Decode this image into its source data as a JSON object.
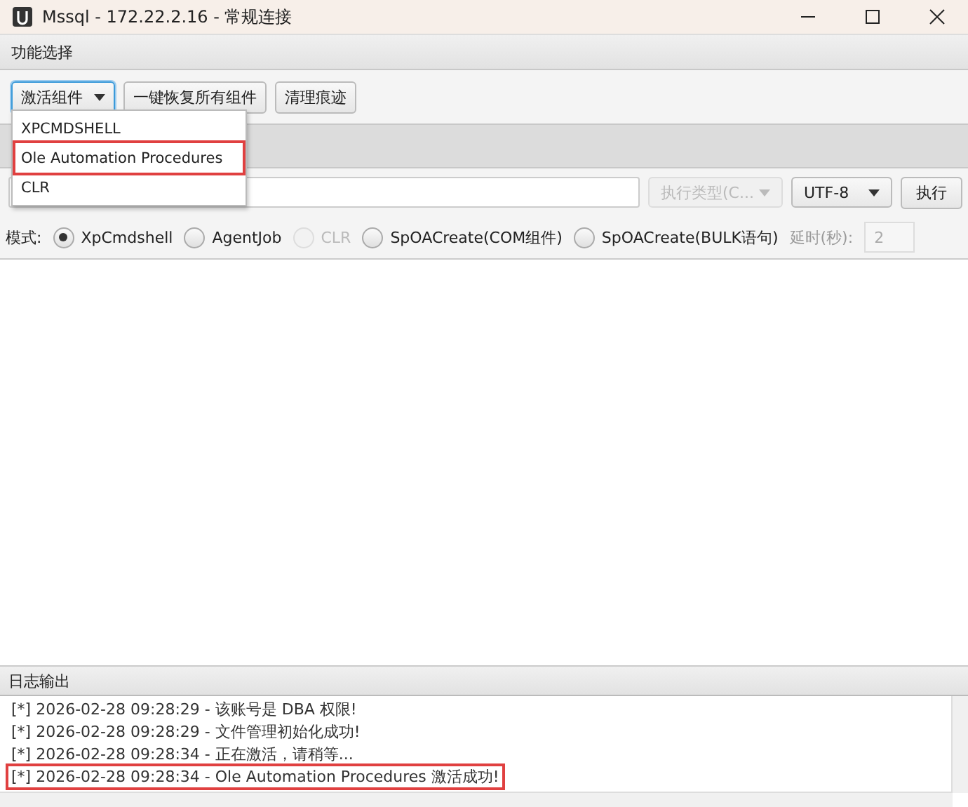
{
  "window": {
    "title": "Mssql - 172.22.2.16 - 常规连接"
  },
  "menu": {
    "label": "功能选择"
  },
  "toolbar": {
    "activate": {
      "label": "激活组件",
      "expanded": true
    },
    "buttons": [
      "一键恢复所有组件",
      "清理痕迹"
    ]
  },
  "dropdown": [
    {
      "label": "XPCMDSHELL",
      "highlighted": false
    },
    {
      "label": "Ole Automation Procedures",
      "highlighted": true
    },
    {
      "label": "CLR",
      "highlighted": false
    }
  ],
  "command": {
    "exec_type": {
      "label": "执行类型(C...",
      "disabled": true
    },
    "encoding": "UTF-8",
    "run": "执行"
  },
  "mode": {
    "label": "模式:",
    "options": [
      {
        "label": "XpCmdshell",
        "selected": true,
        "disabled": false
      },
      {
        "label": "AgentJob",
        "selected": false,
        "disabled": false
      },
      {
        "label": "CLR",
        "selected": false,
        "disabled": true
      },
      {
        "label": "SpOACreate(COM组件)",
        "selected": false,
        "disabled": false
      },
      {
        "label": "SpOACreate(BULK语句)",
        "selected": false,
        "disabled": false
      }
    ],
    "delay_label": "延时(秒):",
    "delay": "2"
  },
  "log": {
    "title": "日志输出",
    "lines": [
      {
        "text": "[*] 2026-02-28 09:28:29 - 该账号是 DBA 权限!",
        "highlighted": false
      },
      {
        "text": "[*] 2026-02-28 09:28:29 - 文件管理初始化成功!",
        "highlighted": false
      },
      {
        "text": "[*] 2026-02-28 09:28:34 - 正在激活，请稍等...",
        "highlighted": false
      },
      {
        "text": "[*] 2026-02-28 09:28:34 - Ole Automation Procedures 激活成功!",
        "highlighted": true
      }
    ]
  }
}
